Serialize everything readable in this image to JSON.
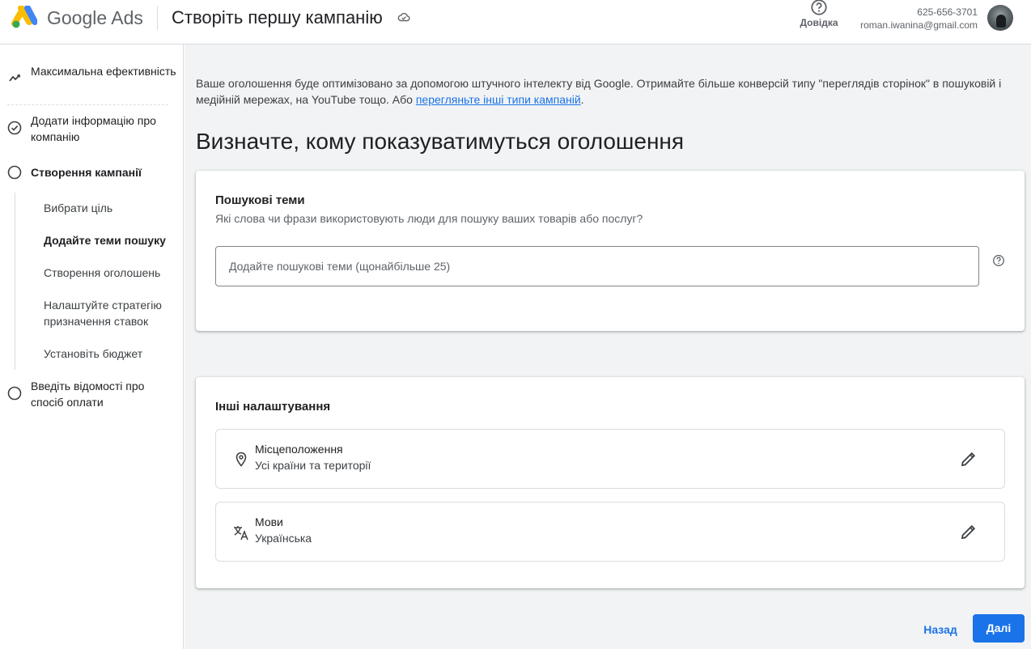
{
  "header": {
    "brand": "Google Ads",
    "title": "Створіть першу кампанію",
    "help_label": "Довідка",
    "account_phone": "625-656-3701",
    "account_email": "roman.iwanina@gmail.com"
  },
  "sidebar": {
    "steps": [
      {
        "label": "Максимальна ефективність",
        "icon": "performance-icon"
      },
      {
        "label": "Додати інформацію про компанію",
        "icon": "check-circle-icon"
      },
      {
        "label": "Створення кампанії",
        "icon": "circle-icon"
      },
      {
        "label": "Введіть відомості про спосіб оплати",
        "icon": "circle-icon"
      }
    ],
    "substeps": [
      {
        "label": "Вибрати ціль"
      },
      {
        "label": "Додайте теми пошуку"
      },
      {
        "label": "Створення оголошень"
      },
      {
        "label": "Налаштуйте стратегію призначення ставок"
      },
      {
        "label": "Установіть бюджет"
      }
    ]
  },
  "main": {
    "intro_text": "Ваше оголошення буде оптимізовано за допомогою штучного інтелекту від Google. Отримайте більше конверсій типу \"переглядів сторінок\" в пошуковій і медійній мережах, на YouTube тощо. Або ",
    "intro_link": "перегляньте інші типи кампаній",
    "intro_end": ".",
    "heading": "Визначте, кому показуватимуться оголошення",
    "search_card": {
      "title": "Пошукові теми",
      "subtitle": "Які слова чи фрази використовують люди для пошуку ваших товарів або послуг?",
      "input_value": "",
      "placeholder": "Додайте пошукові теми (щонайбільше 25)"
    },
    "other_card": {
      "title": "Інші налаштування",
      "rows": [
        {
          "label": "Місцеположення",
          "value": "Усі країни та території",
          "icon": "location-pin-icon"
        },
        {
          "label": "Мови",
          "value": "Українська",
          "icon": "translate-icon"
        }
      ]
    }
  },
  "footer": {
    "back_label": "Назад",
    "next_label": "Далі"
  },
  "colors": {
    "accent": "#1a73e8",
    "background": "#f1f3f4",
    "border": "#dadce0"
  }
}
